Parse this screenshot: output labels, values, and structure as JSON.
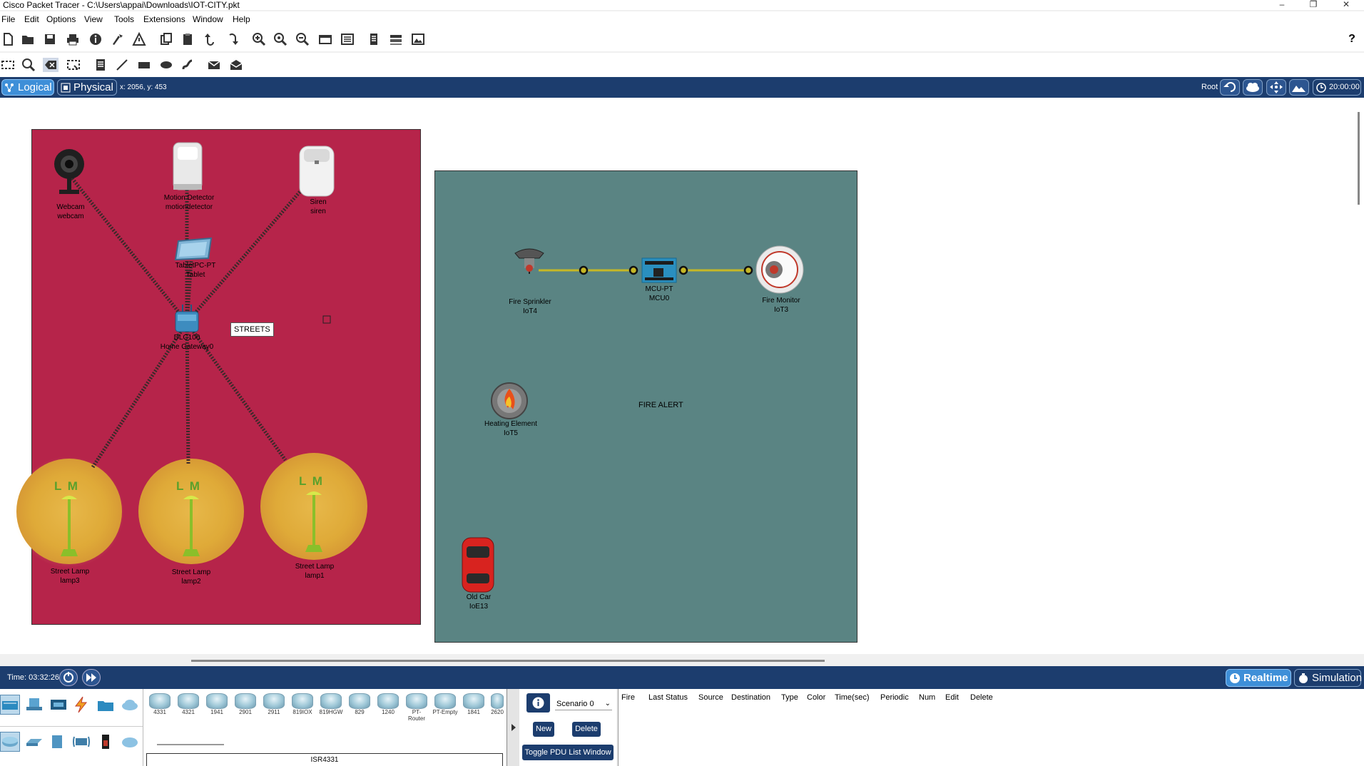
{
  "window": {
    "title": "Cisco Packet Tracer - C:\\Users\\appai\\Downloads\\IOT-CITY.pkt",
    "controls": [
      "–",
      "❐",
      "✕"
    ]
  },
  "menu": [
    "File",
    "Edit",
    "Options",
    "View",
    "Tools",
    "Extensions",
    "Window",
    "Help"
  ],
  "toolbar1": [
    "new-file-icon",
    "open-folder-icon",
    "save-icon",
    "print-icon",
    "info-icon",
    "activity-wizard-icon",
    "network-info-icon",
    "copy-icon",
    "paste-icon",
    "undo-icon",
    "redo-icon",
    "zoom-in-icon",
    "zoom-reset-icon",
    "zoom-out-icon",
    "drawing-palette-icon",
    "custom-device-dialog-icon",
    "view-command-log-icon",
    "cluster-icon",
    "image-icon"
  ],
  "toolbar2": [
    "select-icon",
    "inspect-icon",
    "delete-icon",
    "resize-icon",
    "place-note-icon",
    "draw-line-icon",
    "draw-rectangle-icon",
    "draw-ellipse-icon",
    "freeform-icon",
    "add-simple-pdu-icon",
    "add-complex-pdu-icon"
  ],
  "help_icon": "?",
  "mode": {
    "logical": "Logical",
    "physical": "Physical",
    "coords": "x: 2056, y: 453",
    "root": "Root",
    "time": "20:00:00"
  },
  "workspace": {
    "streets_note": "STREETS",
    "fire_note": "FIRE ALERT",
    "devices": {
      "webcam": [
        "Webcam",
        "webcam"
      ],
      "motion": [
        "Motion Detector",
        "motiondetector"
      ],
      "siren": [
        "Siren",
        "siren"
      ],
      "tablet": [
        "TabletPC-PT",
        "Tablet"
      ],
      "gateway": [
        "DLC100",
        "Home Gateway0"
      ],
      "lamp3": [
        "Street Lamp",
        "lamp3"
      ],
      "lamp2": [
        "Street Lamp",
        "lamp2"
      ],
      "lamp1": [
        "Street Lamp",
        "lamp1"
      ],
      "sprinkler": [
        "Fire Sprinkler",
        "IoT4"
      ],
      "mcu": [
        "MCU-PT",
        "MCU0"
      ],
      "firemonitor": [
        "Fire Monitor",
        "IoT3"
      ],
      "heating": [
        "Heating Element",
        "IoT5"
      ],
      "oldcar": [
        "Old Car",
        "IoE13"
      ]
    },
    "lamp_letters": "L M"
  },
  "bottom": {
    "time": "Time: 03:32:26",
    "realtime": "Realtime",
    "simulation": "Simulation",
    "models": [
      "4331",
      "4321",
      "1941",
      "2901",
      "2911",
      "819IOX",
      "819HGW",
      "829",
      "1240",
      "PT-Router",
      "PT-Empty",
      "1841",
      "2620"
    ],
    "selected_model": "ISR4331",
    "scenario": "Scenario 0",
    "new": "New",
    "delete": "Delete",
    "toggle_pdu": "Toggle PDU List Window",
    "pdu_columns": [
      "Fire",
      "Last Status",
      "Source",
      "Destination",
      "Type",
      "Color",
      "Time(sec)",
      "Periodic",
      "Num",
      "Edit",
      "Delete"
    ]
  },
  "colors": {
    "streets_zone": "#b6244a",
    "fire_zone": "#5a8483",
    "mode_bar": "#1c3d6e",
    "active_mode": "#3e8fd8"
  }
}
